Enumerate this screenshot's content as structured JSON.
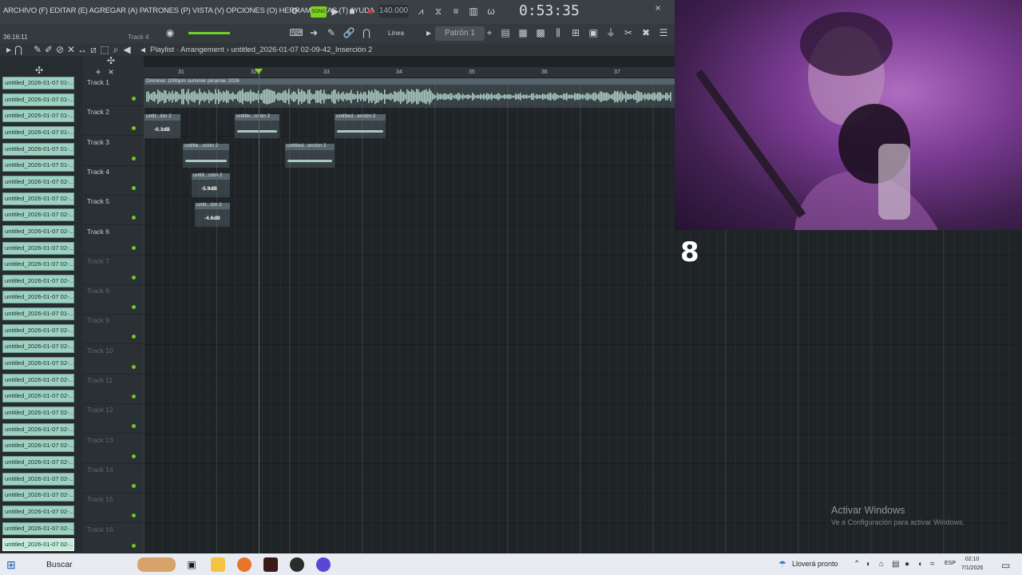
{
  "menu": {
    "text": "ARCHIVO (F) EDITAR (E) AGREGAR (A) PATRONES (P) VISTA (V) OPCIONES (O) HERRAMIENTAS (T) AYUDA"
  },
  "transport": {
    "song_label": "SONG",
    "tempo": "140.000",
    "time": "0:53:35"
  },
  "toolbar": {
    "time_small": "36:16:11",
    "track_selected": "Track 4",
    "snap_mode": "Línea",
    "pattern": "Patrón 1"
  },
  "playlist": {
    "title": "Playlist · Arrangement › untitled_2026-01-07 02-09-42_Inserción 2"
  },
  "ruler": {
    "bars": [
      "31",
      "32",
      "33",
      "34",
      "35",
      "36",
      "37"
    ]
  },
  "browser": {
    "items": [
      "untitled_2026-01-07 01-...",
      "untitled_2026-01-07 01-...",
      "untitled_2026-01-07 01-...",
      "untitled_2026-01-07 01-...",
      "untitled_2026-01-07 01-...",
      "untitled_2026-01-07 01-...",
      "untitled_2026-01-07 02-...",
      "untitled_2026-01-07 02-...",
      "untitled_2026-01-07 02-...",
      "untitled_2026-01-07 02-...",
      "untitled_2026-01-07 02-...",
      "untitled_2026-01-07 02-...",
      "untitled_2026-01-07 02-...",
      "untitled_2026-01-07 02-...",
      "untitled_2026-01-07 01-...",
      "untitled_2026-01-07 02-...",
      "untitled_2026-01-07 02-...",
      "untitled_2026-01-07 02-...",
      "untitled_2026-01-07 02-...",
      "untitled_2026-01-07 02-...",
      "untitled_2026-01-07 02-...",
      "untitled_2026-01-07 02-...",
      "untitled_2026-01-07 02-...",
      "untitled_2026-01-07 02-...",
      "untitled_2026-01-07 02-...",
      "untitled_2026-01-07 02-...",
      "untitled_2026-01-07 02-...",
      "untitled_2026-01-07 02-...",
      "untitled_2026-01-07 02-..."
    ]
  },
  "tracks": [
    {
      "name": "Track 1",
      "active": true
    },
    {
      "name": "Track 2",
      "active": true
    },
    {
      "name": "Track 3",
      "active": true
    },
    {
      "name": "Track 4",
      "active": true
    },
    {
      "name": "Track 5",
      "active": true
    },
    {
      "name": "Track 6",
      "active": true
    },
    {
      "name": "Track 7",
      "active": false
    },
    {
      "name": "Track 8",
      "active": false
    },
    {
      "name": "Track 9",
      "active": false
    },
    {
      "name": "Track 10",
      "active": false
    },
    {
      "name": "Track 11",
      "active": false
    },
    {
      "name": "Track 12",
      "active": false
    },
    {
      "name": "Track 13",
      "active": false
    },
    {
      "name": "Track 14",
      "active": false
    },
    {
      "name": "Track 15",
      "active": false
    },
    {
      "name": "Track 16",
      "active": false
    }
  ],
  "clips": {
    "main": "D#minor 100bpm summer pinamar 2026",
    "t2a": "untit...ión 2",
    "t2a_db": "-0.3dB",
    "t2b": "untitle...rción 2",
    "t2c": "untitled...erción 2",
    "t3a": "untitle...rción 2",
    "t3b": "untitled...erción 2",
    "t4a": "untitl...ción 2",
    "t4a_db": "-5.9dB",
    "t5a": "untit...ión 2",
    "t5a_db": "-4.6dB"
  },
  "overlay": {
    "counter": "8",
    "activate_title": "Activar Windows",
    "activate_sub": "Ve a Configuración para activar Windows."
  },
  "taskbar": {
    "search_placeholder": "Buscar",
    "weather": "Lloverá pronto",
    "language": "ESP",
    "time": "02:10",
    "date": "7/1/2026"
  },
  "colors": {
    "accent_green": "#7bd31e",
    "clip_wave": "#a9c9c0",
    "browser_item": "#9fd1c1"
  }
}
